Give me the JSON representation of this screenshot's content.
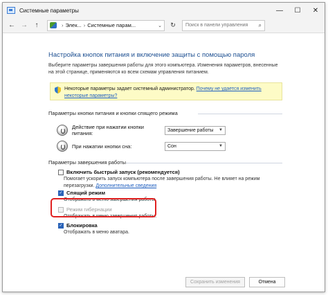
{
  "window": {
    "title": "Системные параметры",
    "controls": {
      "minimize": "—",
      "maximize": "☐",
      "close": "✕"
    }
  },
  "toolbar": {
    "back": "←",
    "forward": "→",
    "up": "↑",
    "breadcrumb": [
      "Элек...",
      "Системные парам..."
    ],
    "breadcrumb_sep": "›",
    "dropdown": "⌄",
    "refresh": "↻",
    "search_placeholder": "Поиск в панели управления"
  },
  "page": {
    "heading": "Настройка кнопок питания и включение защиты с помощью пароля",
    "description": "Выберите параметры завершения работы для этого компьютера. Изменения параметров, внесенные на этой странице, применяются ко всем схемам управления питанием.",
    "info_text": "Некоторые параметры задает системный администратор.",
    "info_link": "Почему не удается изменить",
    "info_link2": "некоторые параметры?"
  },
  "power_buttons": {
    "group_title": "Параметры кнопки питания и кнопки спящего режима",
    "rows": [
      {
        "label": "Действие при нажатии кнопки питания:",
        "value": "Завершение работы"
      },
      {
        "label": "При нажатии кнопки сна:",
        "value": "Сон"
      }
    ]
  },
  "shutdown": {
    "group_title": "Параметры завершения работы",
    "items": [
      {
        "label": "Включить быстрый запуск (рекомендуется)",
        "checked": false,
        "enabled": true,
        "desc1": "Помогает ускорить запуск компьютера после завершения работы. Не влияет на режим",
        "desc2": "перезагрузки.",
        "desc_link": "Дополнительные сведения"
      },
      {
        "label": "Спящий режим",
        "checked": true,
        "enabled": true,
        "desc1": "Отображать в меню завершения работы."
      },
      {
        "label": "Режим гибернации",
        "checked": false,
        "enabled": false,
        "desc1": "Отображать в меню завершения работы."
      },
      {
        "label": "Блокировка",
        "checked": true,
        "enabled": true,
        "desc1": "Отображать в меню аватара."
      }
    ]
  },
  "buttons": {
    "save": "Сохранить изменения",
    "cancel": "Отмена"
  },
  "colors": {
    "heading": "#1d4f91",
    "link": "#1f5fbf",
    "highlight": "#e02020",
    "checkbox_on": "#2a63b8"
  }
}
